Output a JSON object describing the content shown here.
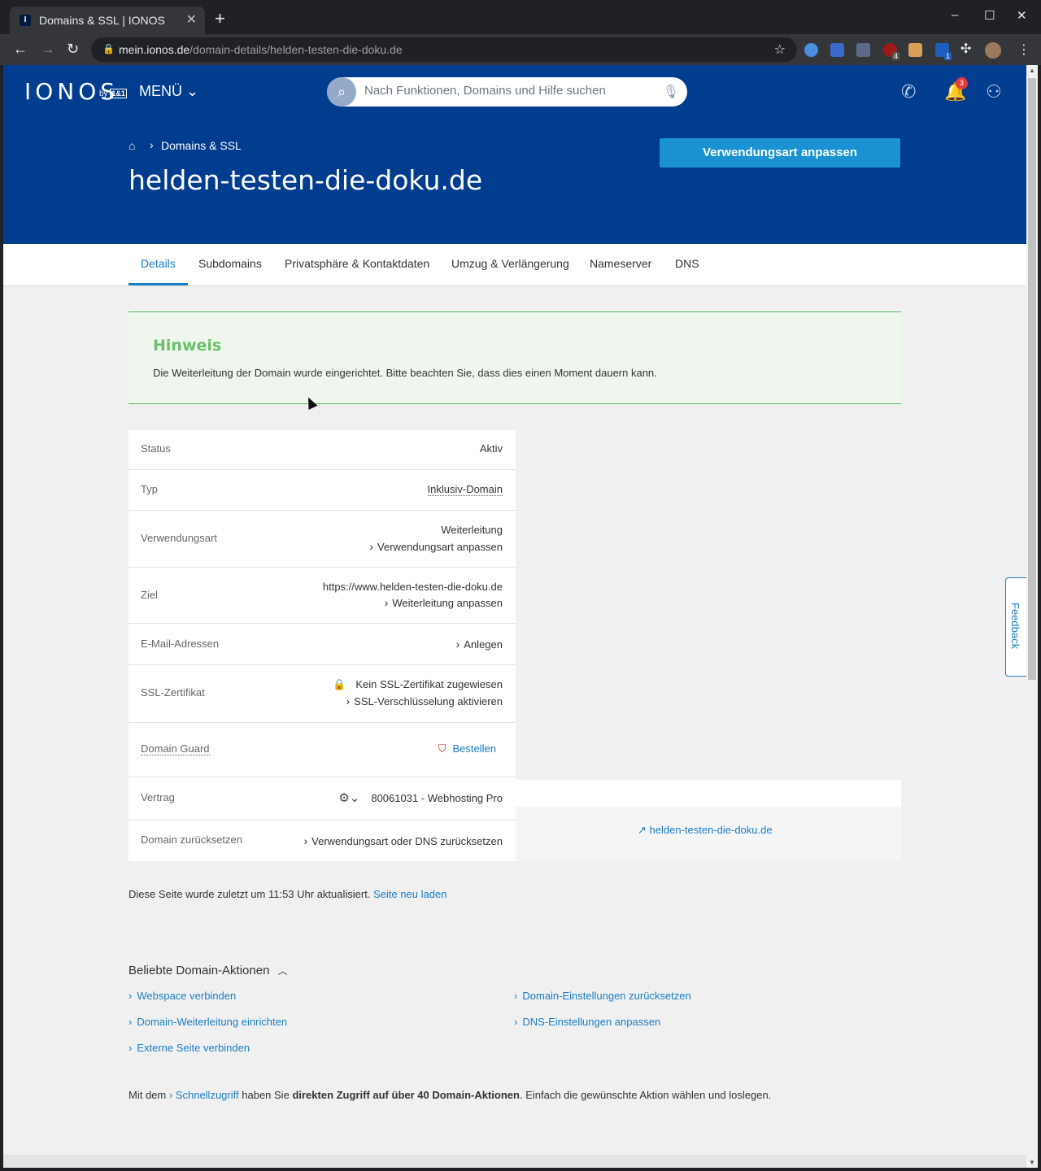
{
  "browser": {
    "tab_title": "Domains & SSL | IONOS",
    "tab_favicon": "I",
    "url_host": "mein.ionos.de",
    "url_path": "/domain-details/helden-testen-die-doku.de",
    "ext_badges": [
      "4",
      "1"
    ]
  },
  "header": {
    "logo": "IONOS",
    "logo_by": "by",
    "logo_brand": "1&1",
    "menu_label": "MENÜ",
    "search_placeholder": "Nach Funktionen, Domains und Hilfe suchen",
    "notification_count": "3"
  },
  "hero": {
    "breadcrumb": "Domains & SSL",
    "title": "helden-testen-die-doku.de",
    "button_label": "Verwendungsart anpassen"
  },
  "tabs": [
    "Details",
    "Subdomains",
    "Privatsphäre & Kontaktdaten",
    "Umzug & Verlängerung",
    "Nameserver",
    "DNS"
  ],
  "hinweis": {
    "title": "Hinweis",
    "text": "Die Weiterleitung der Domain wurde eingerichtet. Bitte beachten Sie, dass dies einen Moment dauern kann."
  },
  "details": {
    "status_label": "Status",
    "status_value": "Aktiv",
    "typ_label": "Typ",
    "typ_value": "Inklusiv-Domain",
    "verwendung_label": "Verwendungsart",
    "verwendung_value": "Weiterleitung",
    "verwendung_link": "Verwendungsart anpassen",
    "ziel_label": "Ziel",
    "ziel_value": "https://www.helden-testen-die-doku.de",
    "ziel_link": "Weiterleitung anpassen",
    "email_label": "E-Mail-Adressen",
    "email_link": "Anlegen",
    "ssl_label": "SSL-Zertifikat",
    "ssl_value": "Kein SSL-Zertifikat zugewiesen",
    "ssl_link": "SSL-Verschlüsselung aktivieren",
    "guard_label": "Domain Guard",
    "guard_link": "Bestellen",
    "vertrag_label": "Vertrag",
    "vertrag_value": "80061031 - Webhosting Pro",
    "reset_label": "Domain zurücksetzen",
    "reset_link": "Verwendungsart oder DNS zurücksetzen"
  },
  "preview_link": "helden-testen-die-doku.de",
  "updated": {
    "text": "Diese Seite wurde zuletzt um 11:53 Uhr aktualisiert.",
    "reload": "Seite neu laden"
  },
  "popular": {
    "title": "Beliebte Domain-Aktionen",
    "left": [
      "Webspace verbinden",
      "Domain-Weiterleitung einrichten",
      "Externe Seite verbinden"
    ],
    "right": [
      "Domain-Einstellungen zurücksetzen",
      "DNS-Einstellungen anpassen"
    ]
  },
  "footnote": {
    "pre": "Mit dem",
    "link": "Schnellzugriff",
    "mid": "haben Sie",
    "bold": "direkten Zugriff auf über 40 Domain-Aktionen",
    "post": ". Einfach die gewünschte Aktion wählen und loslegen."
  },
  "feedback": "Feedback",
  "colors": {
    "brand_blue": "#003d8f",
    "link": "#1a7dc2",
    "success": "#5cb85c",
    "danger": "#c0242a"
  }
}
